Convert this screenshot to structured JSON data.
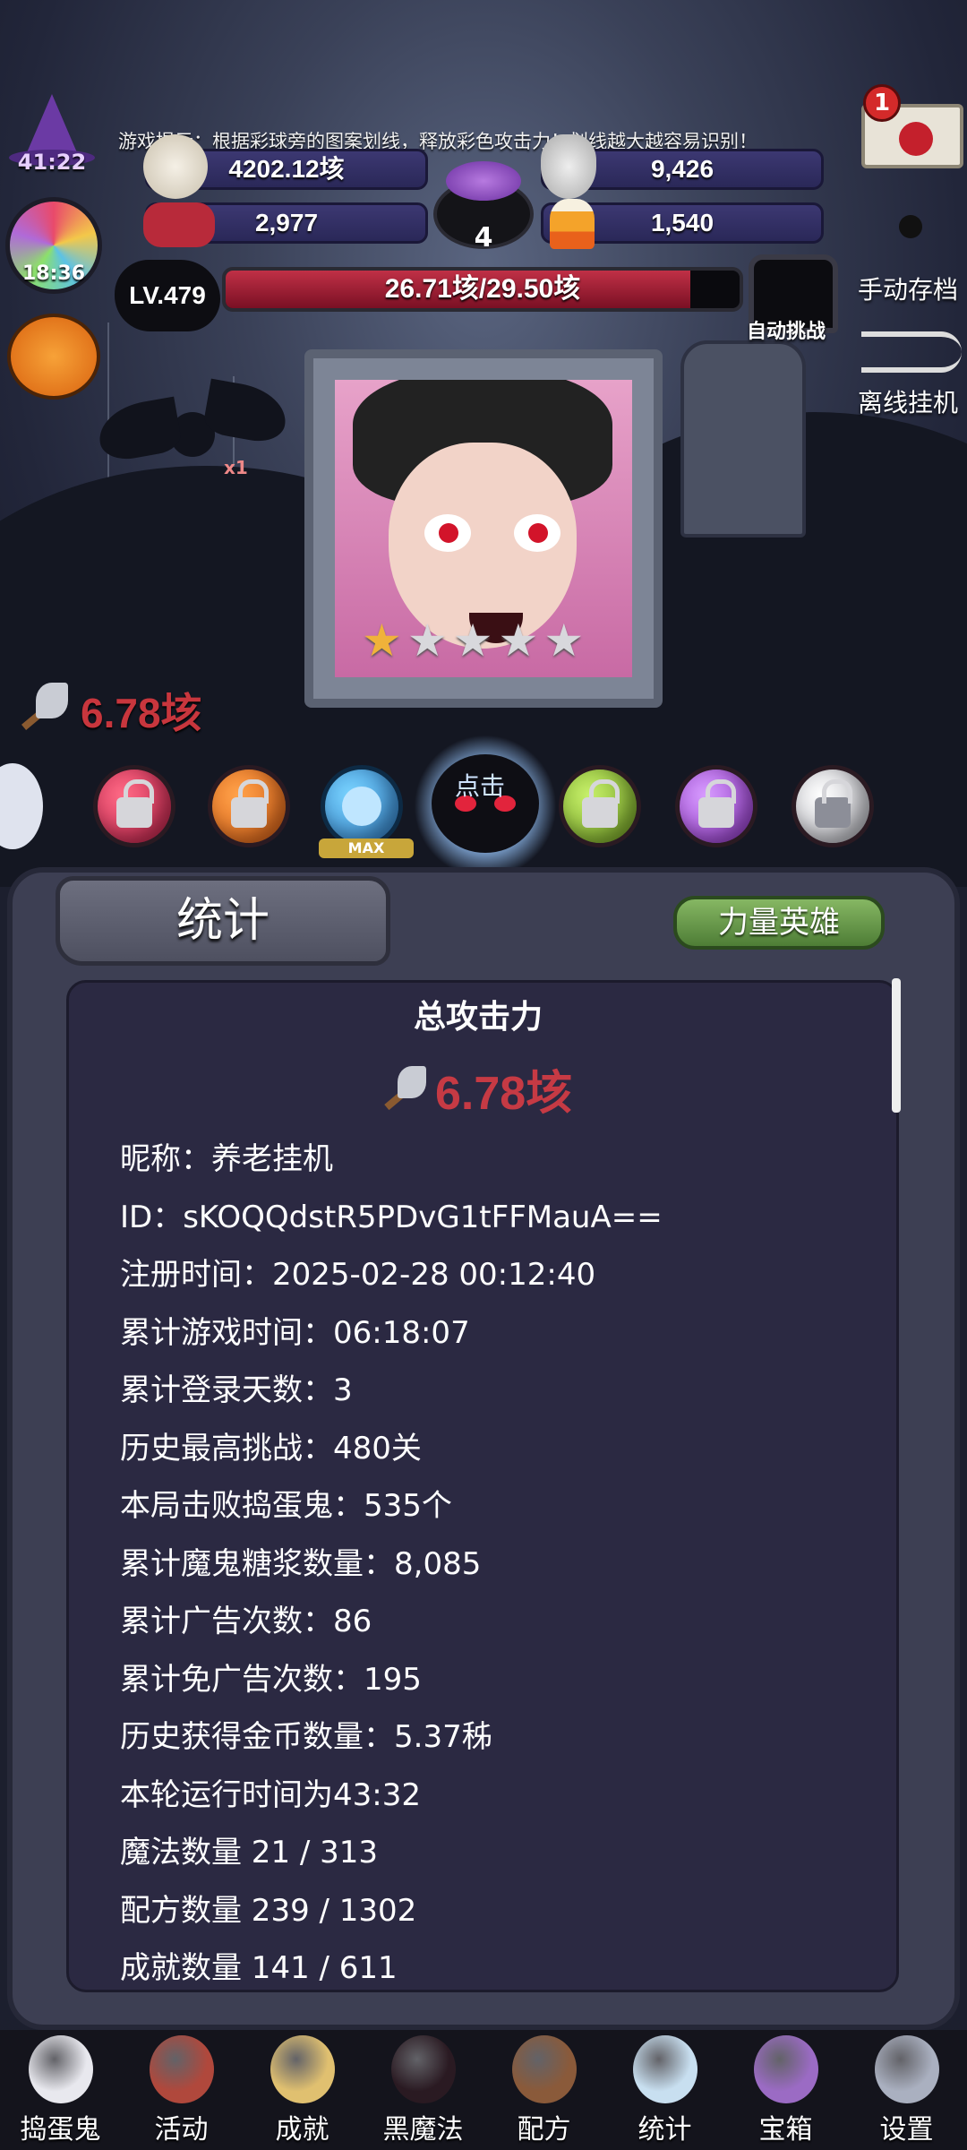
{
  "game_tip": "游戏提示：根据彩球旁的图案划线，释放彩色攻击力！划线越大越容易识别！",
  "hud": {
    "witch_timer": "41:22",
    "candy_timer": "18:36",
    "resource_gold": "4202.12垓",
    "resource_skull": "9,426",
    "resource_candy": "2,977",
    "resource_corn": "1,540",
    "cauldron_count": "4",
    "mail_badge": "1",
    "level": "LV.479",
    "hp_text": "26.71垓/29.50垓",
    "hp_fraction": 0.905,
    "auto_challenge": "自动挑战",
    "manual_save": "手动存档",
    "offline_idle": "离线挂机",
    "bat_multiplier": "x1"
  },
  "boss": {
    "stars_total": 5,
    "stars_filled": 1,
    "damage": "6.78垓"
  },
  "orbs": {
    "max_label": "MAX",
    "tap_label": "点击"
  },
  "panel": {
    "tab_title": "统计",
    "hero_button": "力量英雄",
    "total_attack_title": "总攻击力",
    "total_attack_value": "6.78垓",
    "stats": [
      "昵称：养老挂机",
      "ID：sKOQQdstR5PDvG1tFFMauA==",
      "注册时间：2025-02-28 00:12:40",
      "累计游戏时间：06:18:07",
      "累计登录天数：3",
      "历史最高挑战：480关",
      "本局击败捣蛋鬼：535个",
      "累计魔鬼糖浆数量：8,085",
      "累计广告次数：86",
      "累计免广告次数：195",
      "历史获得金币数量：5.37秭",
      "本轮运行时间为43:32",
      "魔法数量 21 / 313",
      "配方数量 239 / 1302",
      "成就数量 141 / 611"
    ]
  },
  "nav": [
    {
      "label": "捣蛋鬼",
      "icon": "ghost-icon",
      "color": "#e8e8ee"
    },
    {
      "label": "活动",
      "icon": "eyeball-cauldron-icon",
      "color": "#b0483c"
    },
    {
      "label": "成就",
      "icon": "skull-trophy-icon",
      "color": "#e0c070"
    },
    {
      "label": "黑魔法",
      "icon": "devil-cat-icon",
      "color": "#2a1a22"
    },
    {
      "label": "配方",
      "icon": "recipe-book-icon",
      "color": "#8a5a3a"
    },
    {
      "label": "统计",
      "icon": "crystal-ball-icon",
      "color": "#c8dff0"
    },
    {
      "label": "宝箱",
      "icon": "treasure-chest-icon",
      "color": "#9b6bc4"
    },
    {
      "label": "设置",
      "icon": "gear-icon",
      "color": "#aab0c0"
    }
  ]
}
